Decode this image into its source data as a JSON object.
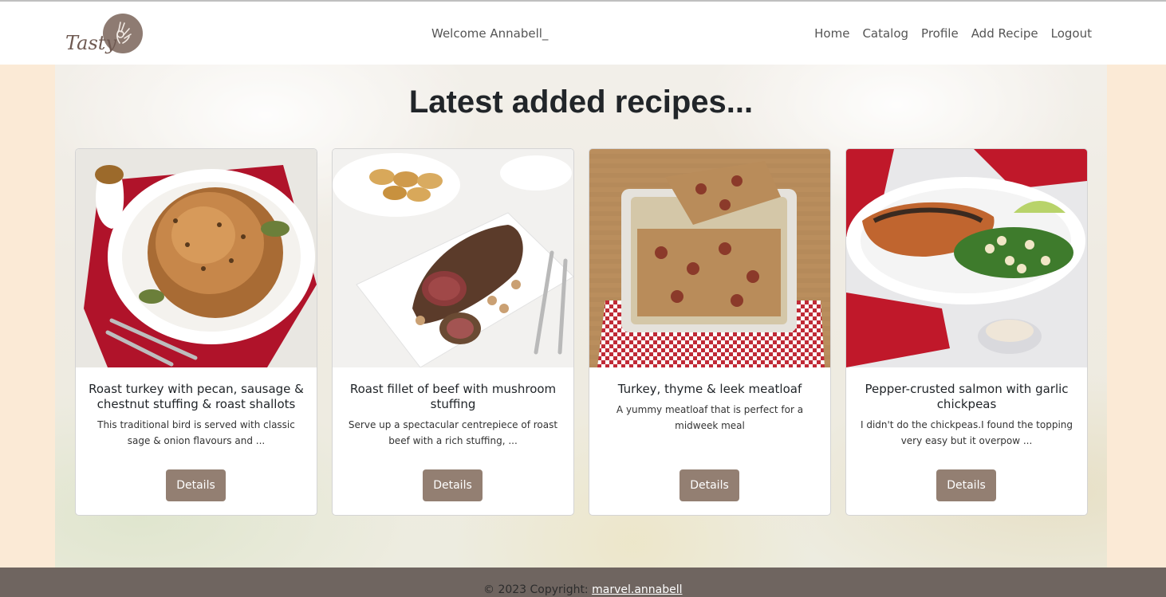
{
  "header": {
    "logo_text": "Tasty",
    "welcome": "Welcome Annabell_",
    "nav": [
      {
        "label": "Home"
      },
      {
        "label": "Catalog"
      },
      {
        "label": "Profile"
      },
      {
        "label": "Add Recipe"
      },
      {
        "label": "Logout"
      }
    ]
  },
  "main": {
    "heading": "Latest added recipes...",
    "cards": [
      {
        "title": "Roast turkey with pecan, sausage & chestnut stuffing & roast shallots",
        "description": "This traditional bird is served with classic sage & onion flavours and ...",
        "button": "Details",
        "image": "roast-turkey-photo"
      },
      {
        "title": "Roast fillet of beef with mushroom stuffing",
        "description": "Serve up a spectacular centrepiece of roast beef with a rich stuffing, ...",
        "button": "Details",
        "image": "roast-beef-photo"
      },
      {
        "title": "Turkey, thyme & leek meatloaf",
        "description": "A yummy meatloaf that is perfect for a midweek meal",
        "button": "Details",
        "image": "meatloaf-photo"
      },
      {
        "title": "Pepper-crusted salmon with garlic chickpeas",
        "description": "I didn't do the chickpeas.I found the topping very easy but it overpow ...",
        "button": "Details",
        "image": "salmon-photo"
      }
    ]
  },
  "footer": {
    "copyright": "© 2023 Copyright: ",
    "author_link": "marvel.annabell"
  },
  "colors": {
    "page_bg": "#fbead6",
    "button_bg": "#937f72",
    "footer_bg": "#6f6560",
    "logo_circle": "#8e7b72"
  }
}
